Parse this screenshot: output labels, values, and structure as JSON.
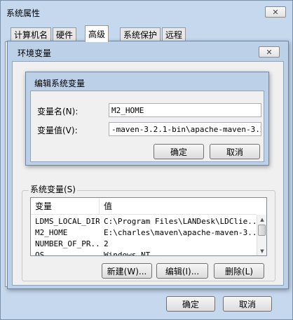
{
  "system_properties": {
    "title": "系统属性",
    "close_glyph": "✕",
    "tabs": [
      {
        "label": "计算机名"
      },
      {
        "label": "硬件"
      },
      {
        "label": "高级"
      },
      {
        "label": "系统保护"
      },
      {
        "label": "远程"
      }
    ],
    "ok_label": "确定",
    "cancel_label": "取消"
  },
  "env_dialog": {
    "title": "环境变量",
    "close_glyph": "✕",
    "system_vars_label": "系统变量(S)",
    "columns": {
      "name": "变量",
      "value": "值"
    },
    "rows": [
      {
        "name": "LDMS_LOCAL_DIR",
        "value": "C:\\Program Files\\LANDesk\\LDClie..."
      },
      {
        "name": "M2_HOME",
        "value": "E:\\charles\\maven\\apache-maven-3...."
      },
      {
        "name": "NUMBER_OF_PR...",
        "value": "2"
      },
      {
        "name": "OS",
        "value": "Windows_NT"
      }
    ],
    "new_label": "新建(W)...",
    "edit_label": "编辑(I)...",
    "delete_label": "删除(L)",
    "ok_label": "确定",
    "cancel_label": "取消"
  },
  "edit_dialog": {
    "title": "编辑系统变量",
    "name_label": "变量名(N):",
    "value_label": "变量值(V):",
    "name_value": "M2_HOME",
    "value_value": "-maven-3.2.1-bin\\apache-maven-3.2.1",
    "ok_label": "确定",
    "cancel_label": "取消"
  },
  "icons": {
    "scroll_up": "▲",
    "scroll_down": "▼"
  },
  "colors": {
    "frame": "#bcd0e8",
    "title_bar": "#a7c4e5",
    "selected_row": "#cde2f8"
  }
}
